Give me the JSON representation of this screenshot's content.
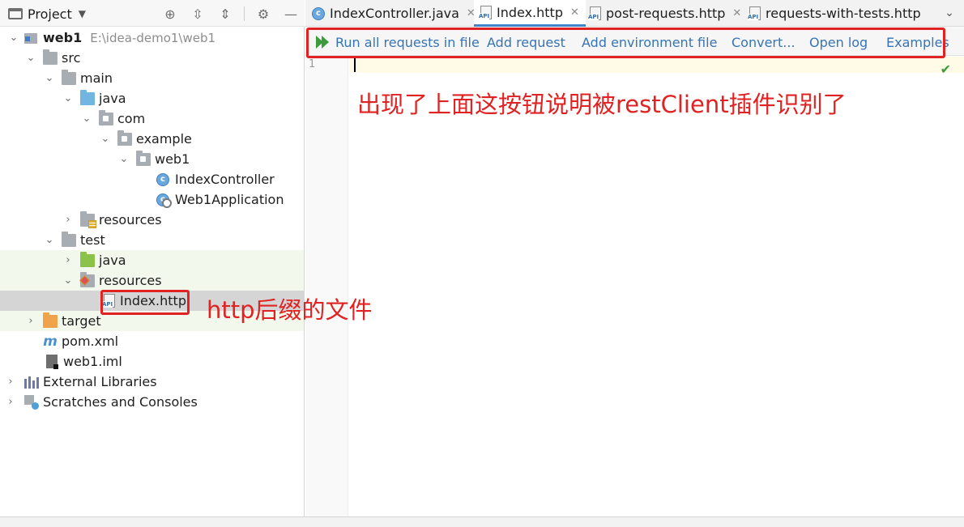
{
  "project_panel": {
    "title": "Project",
    "tree": [
      {
        "label": "web1",
        "path": "E:\\idea-demo1\\web1"
      },
      {
        "label": "src"
      },
      {
        "label": "main"
      },
      {
        "label": "java"
      },
      {
        "label": "com"
      },
      {
        "label": "example"
      },
      {
        "label": "web1"
      },
      {
        "label": "IndexController"
      },
      {
        "label": "Web1Application"
      },
      {
        "label": "resources"
      },
      {
        "label": "test"
      },
      {
        "label": "java"
      },
      {
        "label": "resources"
      },
      {
        "label": "Index.http"
      },
      {
        "label": "target"
      },
      {
        "label": "pom.xml"
      },
      {
        "label": "web1.iml"
      },
      {
        "label": "External Libraries"
      },
      {
        "label": "Scratches and Consoles"
      }
    ]
  },
  "editor": {
    "tabs": [
      {
        "label": "IndexController.java"
      },
      {
        "label": "Index.http"
      },
      {
        "label": "post-requests.http"
      },
      {
        "label": "requests-with-tests.http"
      }
    ],
    "toolbar": {
      "run_all": "Run all requests in file",
      "add_request": "Add request",
      "add_env": "Add environment file",
      "convert": "Convert...",
      "open_log": "Open log",
      "examples": "Examples"
    },
    "line_number": "1"
  },
  "annotations": {
    "toolbar_note": "出现了上面这按钮说明被restClient插件识别了",
    "file_note": "http后缀的文件",
    "color": "#e02222"
  }
}
